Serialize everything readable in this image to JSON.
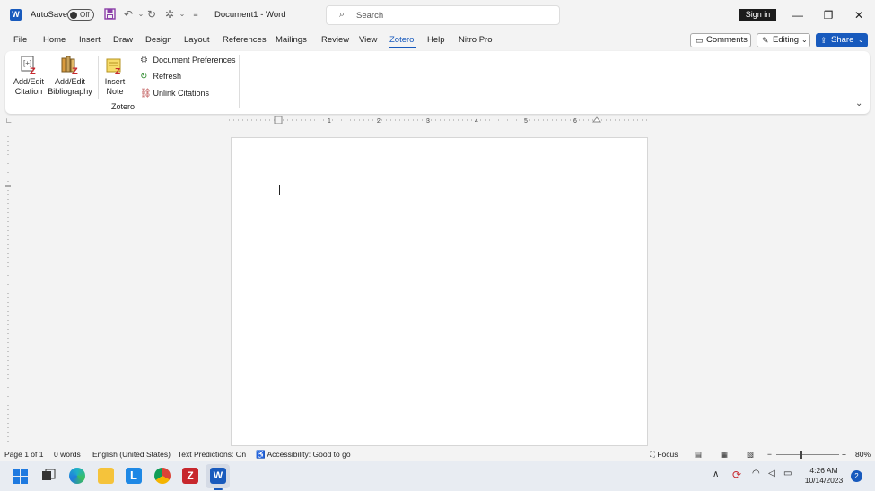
{
  "titlebar": {
    "autosave_label": "AutoSave",
    "autosave_state": "Off",
    "doc_title": "Document1  -  Word",
    "search_placeholder": "Search",
    "signin_label": "Sign in"
  },
  "menu": {
    "tabs": [
      "File",
      "Home",
      "Insert",
      "Draw",
      "Design",
      "Layout",
      "References",
      "Mailings",
      "Review",
      "View",
      "Zotero",
      "Help",
      "Nitro Pro"
    ],
    "active_tab": "Zotero",
    "comments_label": "Comments",
    "editing_label": "Editing",
    "share_label": "Share"
  },
  "ribbon": {
    "add_edit_citation": [
      "Add/Edit",
      "Citation"
    ],
    "add_edit_bibliography": [
      "Add/Edit",
      "Bibliography"
    ],
    "insert_note": [
      "Insert",
      "Note"
    ],
    "document_preferences": "Document Preferences",
    "refresh": "Refresh",
    "unlink_citations": "Unlink Citations",
    "group_label": "Zotero"
  },
  "ruler": {
    "numbers": [
      "1",
      "2",
      "3",
      "4",
      "5",
      "6"
    ]
  },
  "statusbar": {
    "page": "Page 1 of 1",
    "words": "0 words",
    "language": "English (United States)",
    "text_predictions": "Text Predictions: On",
    "accessibility": "Accessibility: Good to go",
    "focus": "Focus",
    "zoom": "80%"
  },
  "taskbar": {
    "time": "4:26 AM",
    "date": "10/14/2023",
    "notification_count": "2"
  },
  "colors": {
    "accent": "#185abd",
    "zotero_red": "#c7272d"
  }
}
